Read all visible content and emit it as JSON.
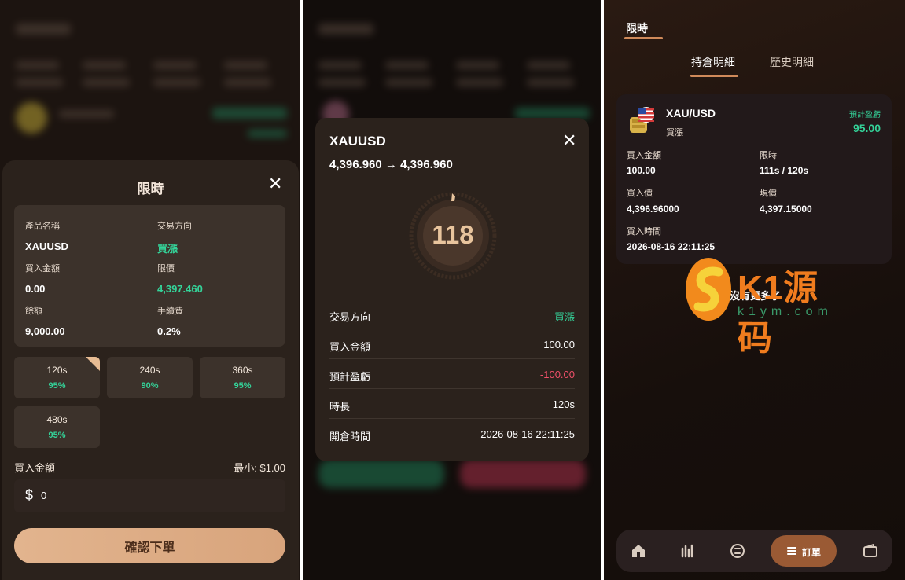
{
  "colors": {
    "accent": "#d08a5a",
    "up": "#34d399",
    "down": "#f0506a",
    "confirm_btn": "#e2b48e",
    "sheet_bg": "#2b221c"
  },
  "order_sheet": {
    "title": "限時",
    "close_icon": "close-icon",
    "fields": {
      "product_label": "產品名稱",
      "product_value": "XAUUSD",
      "direction_label": "交易方向",
      "direction_value": "買漲",
      "amount_label": "買入金額",
      "amount_value": "0.00",
      "limit_label": "限價",
      "limit_value": "4,397.460",
      "balance_label": "餘額",
      "balance_value": "9,000.00",
      "fee_label": "手續費",
      "fee_value": "0.2%"
    },
    "options": [
      {
        "time": "120s",
        "payout": "95%",
        "selected": true
      },
      {
        "time": "240s",
        "payout": "90%",
        "selected": false
      },
      {
        "time": "360s",
        "payout": "95%",
        "selected": false
      },
      {
        "time": "480s",
        "payout": "95%",
        "selected": false
      }
    ],
    "buy_amount_label": "買入金額",
    "min_label": "最小: $1.00",
    "currency_symbol": "$",
    "amount_input": "0",
    "confirm_label": "確認下單"
  },
  "countdown_modal": {
    "symbol": "XAUUSD",
    "price_from": "4,396.960",
    "arrow": "→",
    "price_to": "4,396.960",
    "countdown": "118",
    "rows": [
      {
        "label": "交易方向",
        "value": "買漲",
        "tone": "up"
      },
      {
        "label": "買入金額",
        "value": "100.00",
        "tone": "normal"
      },
      {
        "label": "預計盈虧",
        "value": "-100.00",
        "tone": "down"
      },
      {
        "label": "時長",
        "value": "120s",
        "tone": "normal"
      },
      {
        "label": "開倉時間",
        "value": "2026-08-16 22:11:25",
        "tone": "normal"
      }
    ]
  },
  "orders_page": {
    "top_tab": "限時",
    "tabs": [
      "持倉明細",
      "歷史明細"
    ],
    "position": {
      "pair": "XAU/USD",
      "direction": "買漲",
      "pl_label": "預計盈虧",
      "pl_value": "95.00",
      "amount_label": "買入金額",
      "amount_value": "100.00",
      "limit_label": "限時",
      "limit_value": "111s / 120s",
      "buy_price_label": "買入價",
      "buy_price_value": "4,396.96000",
      "current_label": "現價",
      "current_value": "4,397.15000",
      "buy_time_label": "買入時間",
      "buy_time_value": "2026-08-16 22:11:25"
    },
    "no_more": "沒有更多了",
    "watermark": {
      "main": "K1源码",
      "sub": "k1ym.com"
    },
    "nav": {
      "items": [
        "home-icon",
        "market-chart-icon",
        "exchange-icon",
        "wallet-icon"
      ],
      "active_label": "訂單"
    }
  }
}
